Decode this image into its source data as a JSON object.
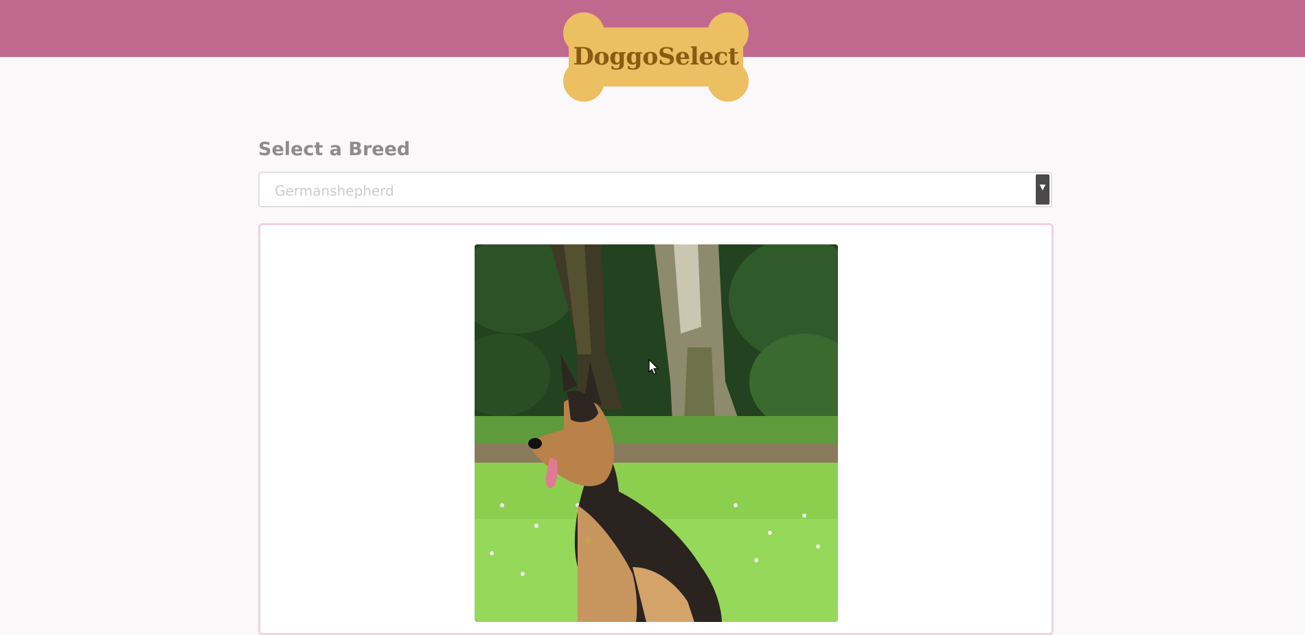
{
  "app": {
    "logo_text": "DoggoSelect"
  },
  "breed_selector": {
    "label": "Select a Breed",
    "selected_value": "Germanshepherd"
  },
  "colors": {
    "header": "#c0698f",
    "logo_bone": "#ecbf62",
    "logo_text": "#8a5a12",
    "card_border": "#f1d2df"
  },
  "icons": {
    "select_arrow": "chevron-down-icon",
    "cursor": "mouse-pointer-icon"
  }
}
